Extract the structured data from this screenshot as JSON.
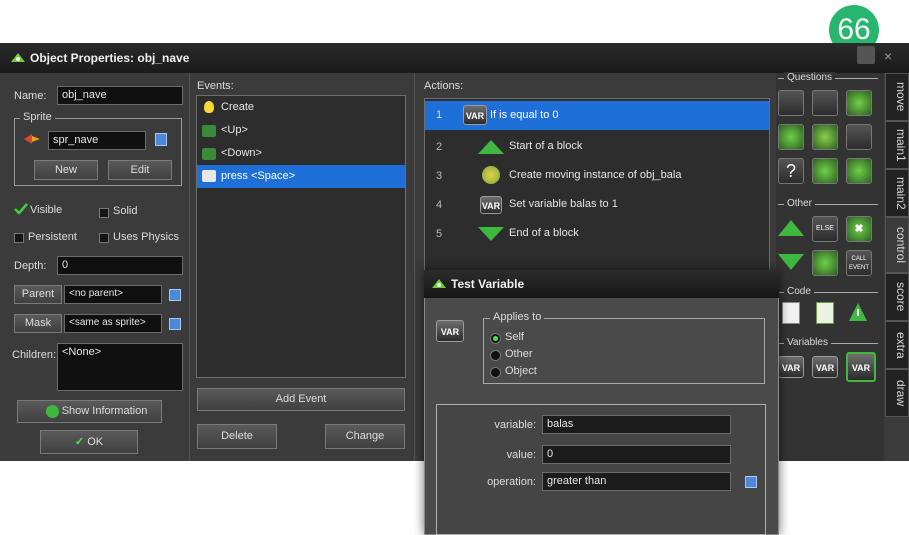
{
  "page_badge": "66",
  "window": {
    "title": "Object Properties: obj_nave",
    "controls": {
      "close": "×"
    }
  },
  "left": {
    "name_label": "Name:",
    "name_value": "obj_nave",
    "sprite_group_label": "Sprite",
    "sprite_value": "spr_nave",
    "new_button": "New",
    "edit_button": "Edit",
    "visible_label": "Visible",
    "solid_label": "Solid",
    "persistent_label": "Persistent",
    "uses_physics_label": "Uses Physics",
    "depth_label": "Depth:",
    "depth_value": "0",
    "parent_button": "Parent",
    "parent_value": "<no parent>",
    "mask_button": "Mask",
    "mask_value": "<same as sprite>",
    "children_label": "Children:",
    "children_value": "<None>",
    "show_info_button": "Show Information",
    "ok_button": "OK"
  },
  "events": {
    "label": "Events:",
    "items": [
      {
        "label": "Create",
        "icon": "lightbulb-icon"
      },
      {
        "label": "<Up>",
        "icon": "keyboard-icon"
      },
      {
        "label": "<Down>",
        "icon": "keyboard-icon"
      },
      {
        "label": "press <Space>",
        "icon": "key-press-icon"
      }
    ],
    "add_event_button": "Add Event",
    "delete_button": "Delete",
    "change_button": "Change"
  },
  "actions": {
    "label": "Actions:",
    "items": [
      {
        "num": "1",
        "label": "If  is equal to 0",
        "icon": "var-icon"
      },
      {
        "num": "2",
        "label": "Start of a block",
        "icon": "triangle-up-icon"
      },
      {
        "num": "3",
        "label": "Create moving instance of obj_bala",
        "icon": "create-instance-icon"
      },
      {
        "num": "4",
        "label": "Set variable balas to 1",
        "icon": "var-icon"
      },
      {
        "num": "5",
        "label": "End of a block",
        "icon": "triangle-down-icon"
      }
    ]
  },
  "palette": {
    "questions_label": "Questions",
    "other_label": "Other",
    "code_label": "Code",
    "variables_label": "Variables",
    "else_label": "ELSE",
    "call_event_label": "CALL EVENT",
    "var_label": "VAR",
    "tabs": [
      "move",
      "main1",
      "main2",
      "control",
      "score",
      "extra",
      "draw"
    ]
  },
  "dialog": {
    "title": "Test Variable",
    "applies_to_label": "Applies to",
    "options": [
      "Self",
      "Other",
      "Object"
    ],
    "var_label": "VAR",
    "variable_label": "variable:",
    "variable_value": "balas",
    "value_label": "value:",
    "value_value": "0",
    "operation_label": "operation:",
    "operation_value": "greater than"
  },
  "colors": {
    "selection": "#1f6fd8",
    "accent_green": "#27b66d"
  }
}
